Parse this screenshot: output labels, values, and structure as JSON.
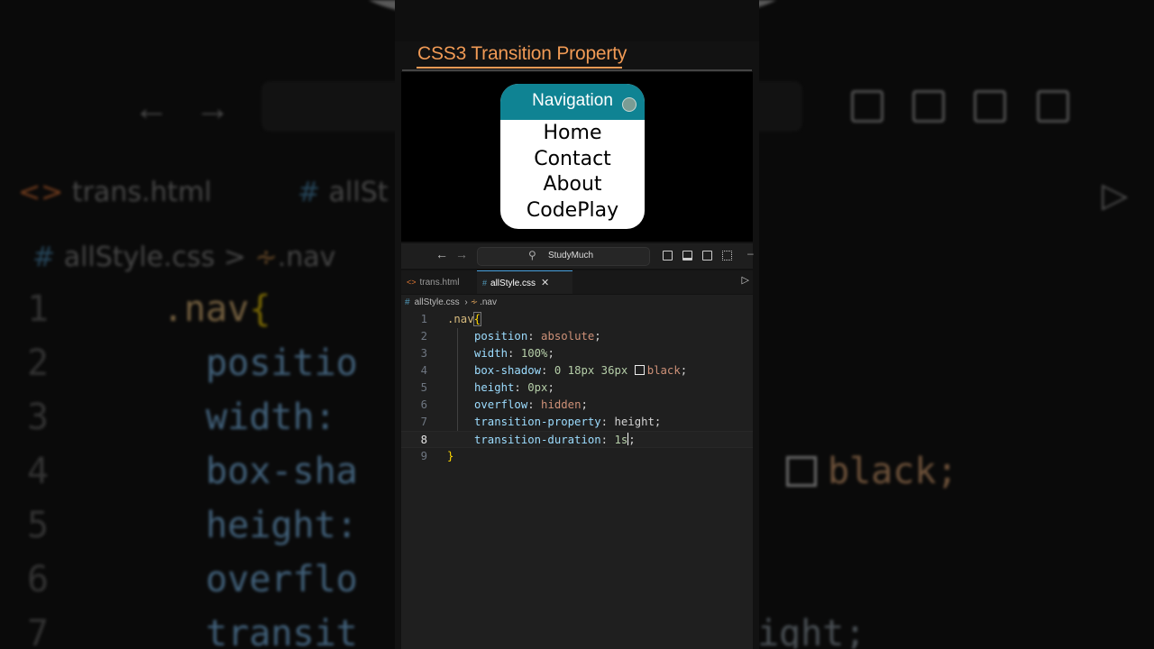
{
  "overlay_title": "CSS3 Transition Property",
  "demo": {
    "nav_header": "Navigation",
    "links": [
      "Home",
      "Contact",
      "About",
      "CodePlay"
    ]
  },
  "titlebar": {
    "back_icon": "arrow-left-icon",
    "forward_icon": "arrow-right-icon",
    "search_text": "StudyMuch"
  },
  "tabs": [
    {
      "label": "trans.html",
      "icon": "html-file-icon",
      "active": false
    },
    {
      "label": "allStyle.css",
      "icon": "css-file-icon",
      "active": true
    }
  ],
  "breadcrumb": {
    "file": "allStyle.css",
    "symbol": ".nav"
  },
  "code_lines": [
    {
      "n": "1",
      "parts": [
        {
          "t": ".nav",
          "c": "sel"
        },
        {
          "t": "{",
          "c": "br"
        }
      ]
    },
    {
      "n": "2",
      "parts": [
        {
          "t": "position",
          "c": "prop"
        },
        {
          "t": ": ",
          "c": "plain"
        },
        {
          "t": "absolute",
          "c": "val"
        },
        {
          "t": ";",
          "c": "plain"
        }
      ]
    },
    {
      "n": "3",
      "parts": [
        {
          "t": "width",
          "c": "prop"
        },
        {
          "t": ": ",
          "c": "plain"
        },
        {
          "t": "100%",
          "c": "num"
        },
        {
          "t": ";",
          "c": "plain"
        }
      ]
    },
    {
      "n": "4",
      "parts": [
        {
          "t": "box-shadow",
          "c": "prop"
        },
        {
          "t": ": ",
          "c": "plain"
        },
        {
          "t": "0 18px 36px ",
          "c": "num"
        },
        {
          "t": "black",
          "c": "val",
          "swatch": true
        },
        {
          "t": ";",
          "c": "plain"
        }
      ]
    },
    {
      "n": "5",
      "parts": [
        {
          "t": "height",
          "c": "prop"
        },
        {
          "t": ": ",
          "c": "plain"
        },
        {
          "t": "0px",
          "c": "num"
        },
        {
          "t": ";",
          "c": "plain"
        }
      ]
    },
    {
      "n": "6",
      "parts": [
        {
          "t": "overflow",
          "c": "prop"
        },
        {
          "t": ": ",
          "c": "plain"
        },
        {
          "t": "hidden",
          "c": "val"
        },
        {
          "t": ";",
          "c": "plain"
        }
      ]
    },
    {
      "n": "7",
      "parts": [
        {
          "t": "transition-property",
          "c": "prop"
        },
        {
          "t": ": ",
          "c": "plain"
        },
        {
          "t": "height",
          "c": "plain"
        },
        {
          "t": ";",
          "c": "plain"
        }
      ]
    },
    {
      "n": "8",
      "parts": [
        {
          "t": "transition-duration",
          "c": "prop"
        },
        {
          "t": ": ",
          "c": "plain"
        },
        {
          "t": "1s",
          "c": "num",
          "caret": true
        },
        {
          "t": ";",
          "c": "plain"
        }
      ]
    },
    {
      "n": "9",
      "parts": [
        {
          "t": "}",
          "c": "br"
        }
      ]
    }
  ],
  "active_line": "8",
  "colors": {
    "title": "#f09a55",
    "nav_header_bg": "#0f8393",
    "property": "#9cdcfe",
    "value": "#ce9178",
    "number": "#b5cea8",
    "selector": "#d7ba7d"
  }
}
